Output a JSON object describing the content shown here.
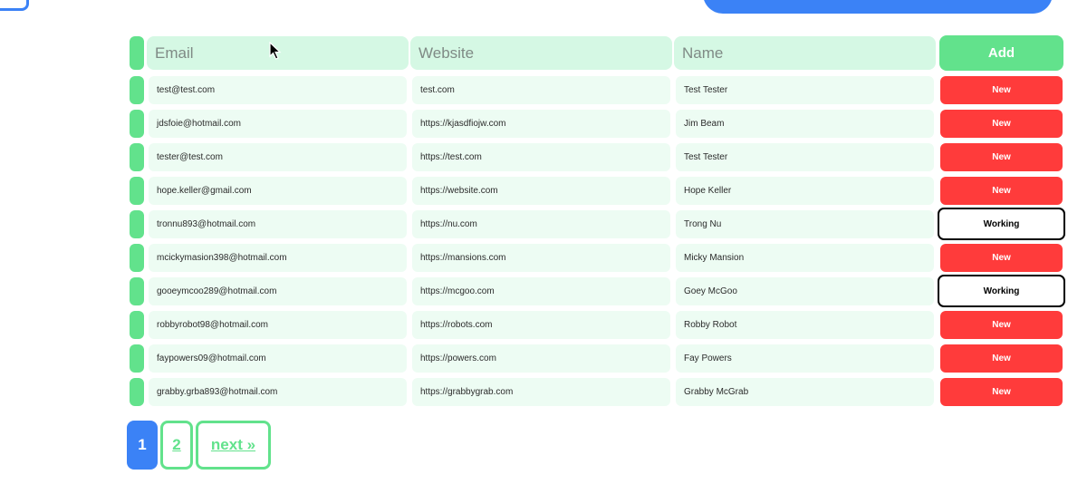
{
  "table": {
    "headers": {
      "email": "Email",
      "website": "Website",
      "name": "Name",
      "add": "Add"
    },
    "rows": [
      {
        "email": "test@test.com",
        "website": "test.com",
        "name": "Test Tester",
        "status": "New"
      },
      {
        "email": "jdsfoie@hotmail.com",
        "website": "https://kjasdfiojw.com",
        "name": "Jim Beam",
        "status": "New"
      },
      {
        "email": "tester@test.com",
        "website": "https://test.com",
        "name": "Test Tester",
        "status": "New"
      },
      {
        "email": "hope.keller@gmail.com",
        "website": "https://website.com",
        "name": "Hope Keller",
        "status": "New"
      },
      {
        "email": "tronnu893@hotmail.com",
        "website": "https://nu.com",
        "name": "Trong Nu",
        "status": "Working"
      },
      {
        "email": "mcickymasion398@hotmail.com",
        "website": "https://mansions.com",
        "name": "Micky Mansion",
        "status": "New"
      },
      {
        "email": "gooeymcoo289@hotmail.com",
        "website": "https://mcgoo.com",
        "name": "Goey McGoo",
        "status": "Working"
      },
      {
        "email": "robbyrobot98@hotmail.com",
        "website": "https://robots.com",
        "name": "Robby Robot",
        "status": "New"
      },
      {
        "email": "faypowers09@hotmail.com",
        "website": "https://powers.com",
        "name": "Fay Powers",
        "status": "New"
      },
      {
        "email": "grabby.grba893@hotmail.com",
        "website": "https://grabbygrab.com",
        "name": "Grabby McGrab",
        "status": "New"
      }
    ]
  },
  "pagination": {
    "pages": [
      "1",
      "2"
    ],
    "current": "1",
    "next_label": "next »"
  },
  "colors": {
    "accent_green": "#62e28c",
    "status_new": "#ff3b3b",
    "brand_blue": "#3b82f6",
    "cell_bg": "#edfcf3",
    "header_bg": "#d5f8e4"
  },
  "icons": {
    "cursor": "arrow-cursor-icon"
  }
}
